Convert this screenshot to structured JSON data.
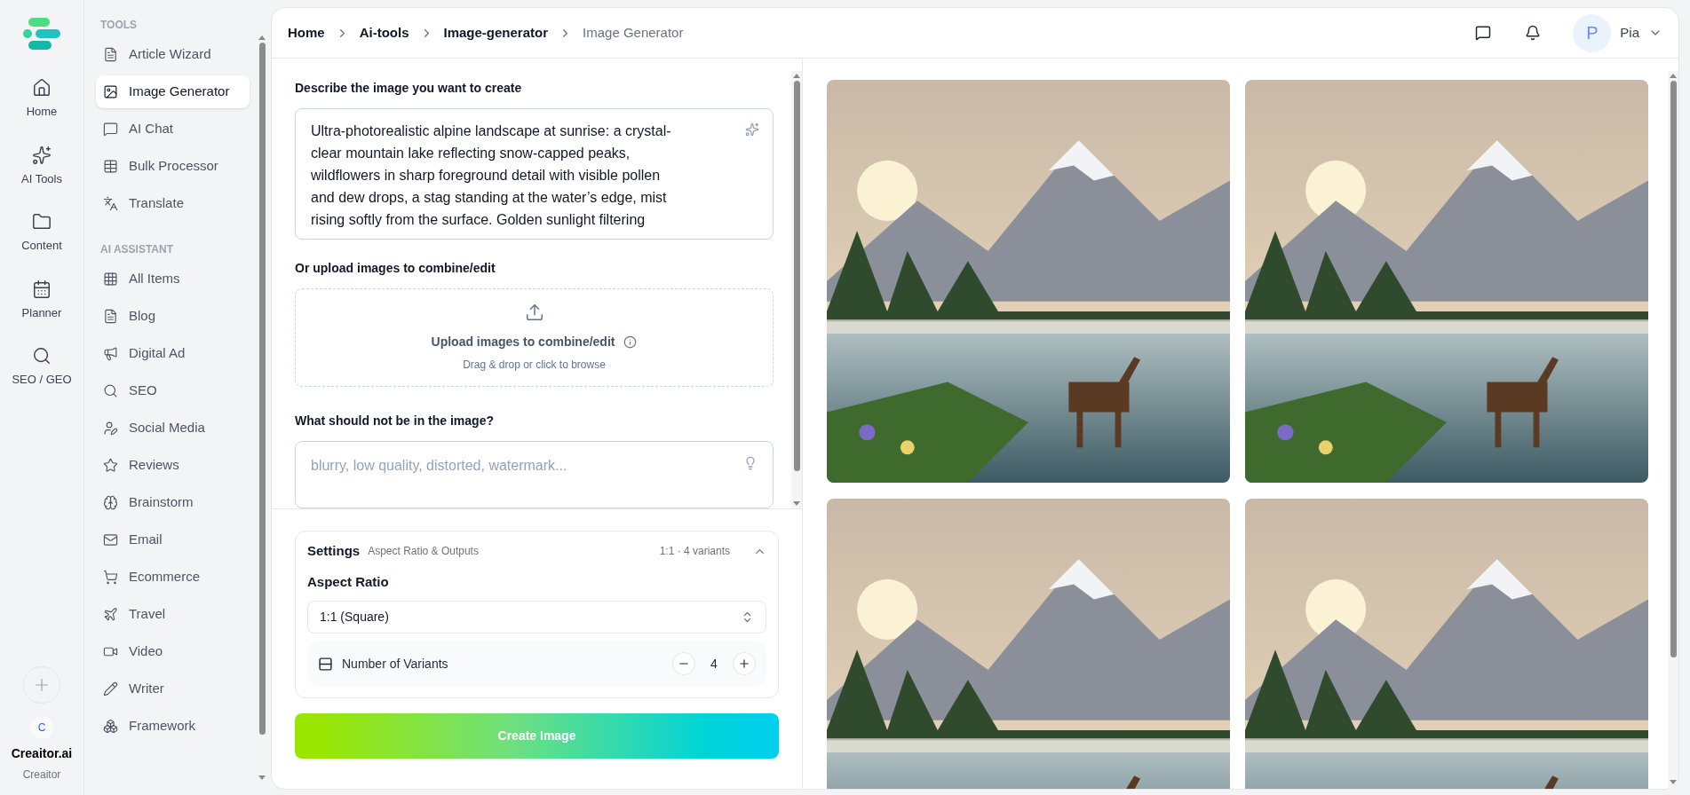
{
  "rail": {
    "items": [
      {
        "label": "Home",
        "selected": false
      },
      {
        "label": "AI Tools",
        "selected": false
      },
      {
        "label": "Content",
        "selected": false
      },
      {
        "label": "Planner",
        "selected": false
      },
      {
        "label": "SEO / GEO",
        "selected": false
      }
    ],
    "workspace": {
      "initial": "C",
      "name": "Creaitor.ai",
      "subtitle": "Creaitor"
    }
  },
  "sidebar": {
    "sections": [
      {
        "title": "TOOLS",
        "items": [
          {
            "label": "Article Wizard",
            "selected": false
          },
          {
            "label": "Image Generator",
            "selected": true
          },
          {
            "label": "AI Chat",
            "selected": false
          },
          {
            "label": "Bulk Processor",
            "selected": false
          },
          {
            "label": "Translate",
            "selected": false
          }
        ]
      },
      {
        "title": "AI ASSISTANT",
        "items": [
          {
            "label": "All Items",
            "selected": false
          },
          {
            "label": "Blog",
            "selected": false
          },
          {
            "label": "Digital Ad",
            "selected": false
          },
          {
            "label": "SEO",
            "selected": false
          },
          {
            "label": "Social Media",
            "selected": false
          },
          {
            "label": "Reviews",
            "selected": false
          },
          {
            "label": "Brainstorm",
            "selected": false
          },
          {
            "label": "Email",
            "selected": false
          },
          {
            "label": "Ecommerce",
            "selected": false
          },
          {
            "label": "Travel",
            "selected": false
          },
          {
            "label": "Video",
            "selected": false
          },
          {
            "label": "Writer",
            "selected": false
          },
          {
            "label": "Framework",
            "selected": false
          }
        ]
      }
    ]
  },
  "header": {
    "breadcrumb": [
      {
        "label": "Home",
        "current": false
      },
      {
        "label": "Ai-tools",
        "current": false
      },
      {
        "label": "Image-generator",
        "current": false
      },
      {
        "label": "Image Generator",
        "current": true
      }
    ],
    "user": {
      "initial": "P",
      "name": "Pia"
    }
  },
  "form": {
    "prompt_label": "Describe the image you want to create",
    "prompt_value": "Ultra-photorealistic alpine landscape at sunrise: a crystal-clear mountain lake reflecting snow-capped peaks, wildflowers in sharp foreground detail with visible pollen and dew drops, a stag standing at the water’s edge, mist rising softly from the surface. Golden sunlight filtering",
    "upload_label": "Or upload images to combine/edit",
    "upload_title": "Upload images to combine/edit",
    "upload_hint": "Drag & drop or click to browse",
    "negative_label": "What should not be in the image?",
    "negative_placeholder": "blurry, low quality, distorted, watermark...",
    "settings": {
      "title": "Settings",
      "subtitle": "Aspect Ratio & Outputs",
      "summary": "1:1 · 4 variants",
      "expanded": true,
      "aspect_label": "Aspect Ratio",
      "aspect_value": "1:1 (Square)",
      "variants_label": "Number of Variants",
      "variants_value": "4"
    },
    "create_button": "Create Image"
  }
}
